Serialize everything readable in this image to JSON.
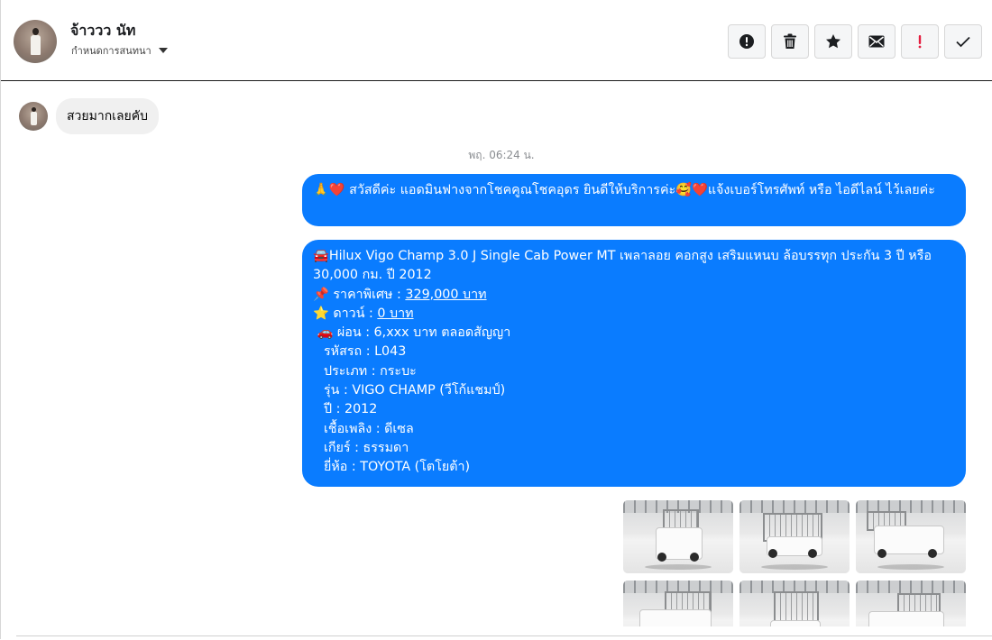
{
  "header": {
    "contact_name": "จ้าววว นัท",
    "assign_label": "กำหนดการสนทนา",
    "tools": [
      {
        "name": "alert-icon-button",
        "icon": "exclamation-circle-icon"
      },
      {
        "name": "delete-button",
        "icon": "trash-icon"
      },
      {
        "name": "star-button",
        "icon": "star-icon"
      },
      {
        "name": "mark-unread-button",
        "icon": "envelope-icon"
      },
      {
        "name": "spam-button",
        "icon": "red-exclamation-icon"
      },
      {
        "name": "done-button",
        "icon": "check-icon"
      }
    ]
  },
  "messages": {
    "incoming_text": "สวยมากเลยคับ",
    "timestamp": "พฤ. 06:24 น.",
    "greeting": {
      "emoji_left": "🙏❤️",
      "text": "สวัสดีค่ะ แอดมินฟางจากโชคคูณโชคอุดร ยินดีให้บริการค่ะ",
      "emoji_mid": "🥰❤️",
      "text2": "แจ้งเบอร์โทรศัพท์ หรือ ไอดีไลน์  ไว้เลยค่ะ"
    },
    "listing": {
      "title_emoji": "🚘",
      "title": "Hilux Vigo Champ 3.0 J Single Cab Power MT เพลาลอย คอกสูง เสริมแหนบ ล้อบรรทุก ประกัน 3 ปี หรือ 30,000 กม. ปี 2012",
      "price_emoji": "📌",
      "price_label": "ราคาพิเศษ : ",
      "price_value": "329,000 บาท",
      "down_emoji": "⭐",
      "down_label": "ดาวน์ : ",
      "down_value": "0 บาท",
      "installment_emoji": "🚗",
      "installment": "ผ่อน : 6,xxx บาท ตลอดสัญญา",
      "code": "รหัสรถ : L043",
      "type": "ประเภท : กระบะ",
      "model": "รุ่น : VIGO CHAMP (วีโก้แชมป์)",
      "year": "ปี : 2012",
      "fuel": "เชื้อเพลิง : ดีเซล",
      "gear": "เกียร์ : ธรรมดา",
      "brand": "ยี่ห้อ : TOYOTA (โตโยต้า)"
    },
    "photos": [
      {
        "view": "front-left"
      },
      {
        "view": "rear"
      },
      {
        "view": "front-right"
      },
      {
        "view": "side-left"
      },
      {
        "view": "rear-cage"
      },
      {
        "view": "side-right"
      }
    ]
  },
  "colors": {
    "outgoing_bubble": "#0a7cff",
    "incoming_bubble": "#f0f0f0",
    "spam_red": "#e41e3f"
  }
}
